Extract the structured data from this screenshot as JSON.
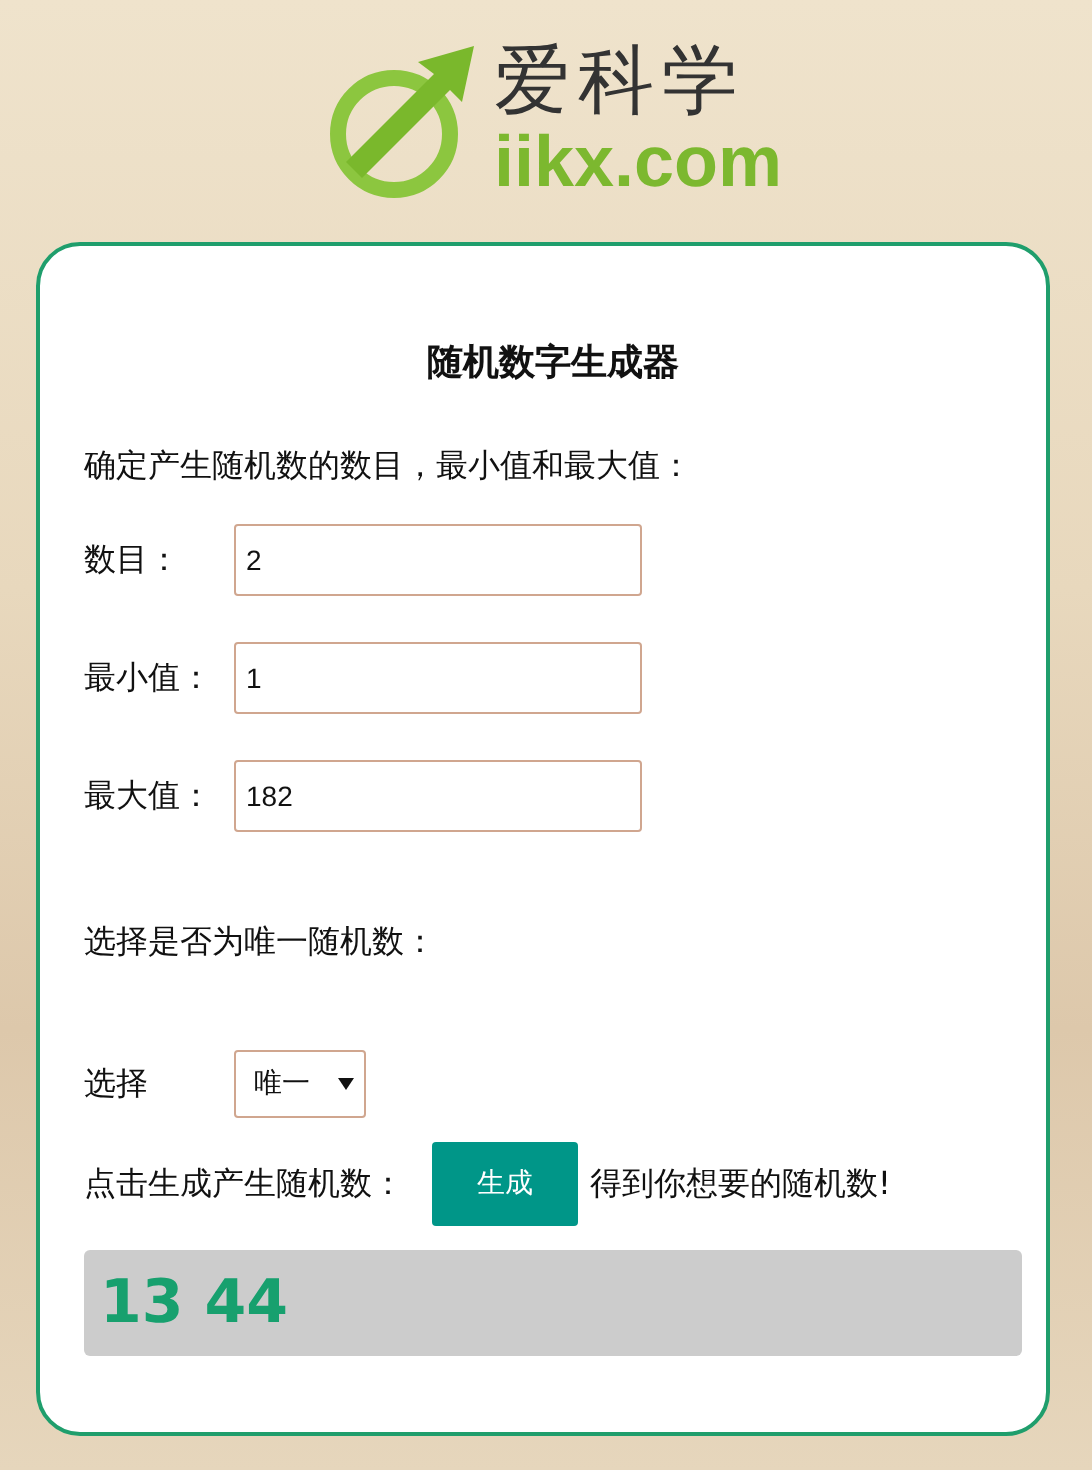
{
  "logo": {
    "title": "爱科学",
    "domain": "iikx.com"
  },
  "heading": "随机数字生成器",
  "intro": "确定产生随机数的数目，最小值和最大值：",
  "fields": [
    {
      "label": "数目：",
      "value": "2"
    },
    {
      "label": "最小值：",
      "value": "1"
    },
    {
      "label": "最大值：",
      "value": "182"
    }
  ],
  "unique_prompt": "选择是否为唯一随机数：",
  "select": {
    "label": "选择",
    "value": "唯一"
  },
  "generate": {
    "before": "点击生成产生随机数：",
    "button": "生成",
    "after": "得到你想要的随机数!"
  },
  "result": "13 44"
}
